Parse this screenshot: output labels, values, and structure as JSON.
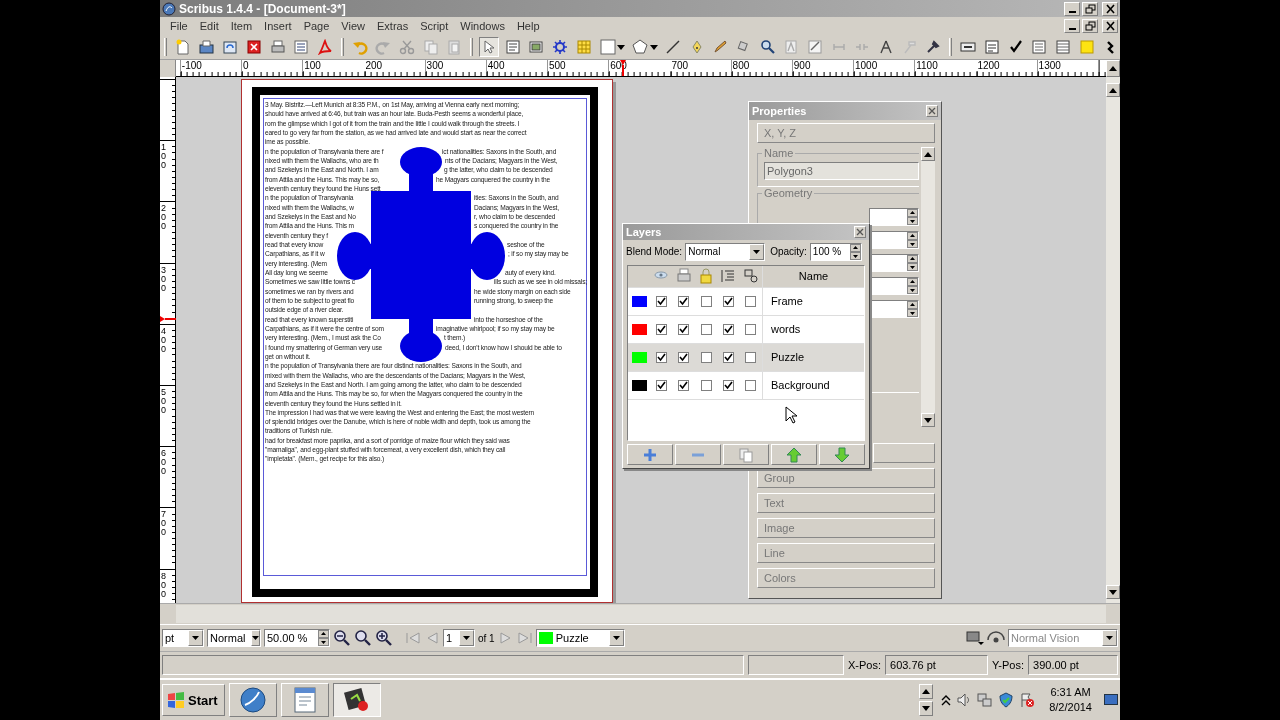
{
  "window": {
    "title": "Scribus 1.4.4 - [Document-3*]"
  },
  "menu": [
    "File",
    "Edit",
    "Item",
    "Insert",
    "Page",
    "View",
    "Extras",
    "Script",
    "Windows",
    "Help"
  ],
  "ruler_h": [
    "-100",
    "0",
    "100",
    "200",
    "300",
    "400",
    "500",
    "600",
    "700",
    "800",
    "900",
    "1000",
    "1100",
    "1200",
    "1300"
  ],
  "ruler_v": [
    "100",
    "200",
    "300",
    "400",
    "500",
    "600",
    "700",
    "800"
  ],
  "document": {
    "lines": [
      {
        "text": "3 May. Bistritz.—Left Munich at 8:35 P.M., on 1st May, arriving at Vienna early next morning;"
      },
      {
        "text": "should have arrived at 6:46, but train was an hour late. Buda-Pesth seems a wonderful place,"
      },
      {
        "text": "rom the glimpse which I got of it from the train and the little I could walk through the streets. I"
      },
      {
        "text": "eared to go very far from the station, as we had arrived late and would start as near the correct"
      },
      {
        "text": "ime as possible."
      },
      {
        "text": "n the population of Transylvania there are f",
        "text_after_puzzle": "ict nationalities: Saxons in the South, and"
      },
      {
        "text": "nixed with them the Wallachs, who are th",
        "text_after_puzzle": "nts of the Dacians; Magyars in the West,"
      },
      {
        "text": "and Szekelys in the East and North. I am",
        "text_after_puzzle": "g the latter, who claim to be descended"
      },
      {
        "text": "from Attila and the Huns. This may be so,",
        "text_after_puzzle": "he Magyars conquered the country in the"
      },
      {
        "text": "eleventh century they found the Huns sett"
      },
      {
        "text": "n the population of Transylvania",
        "text_after_puzzle": "ities: Saxons in the South, and"
      },
      {
        "text": "nixed with them the Wallachs, w",
        "text_after_puzzle": "Dacians; Magyars in the West,"
      },
      {
        "text": "and Szekelys in the East and No",
        "text_after_puzzle": "r, who claim to be descended"
      },
      {
        "text": "from Attila and the Huns. This m",
        "text_after_puzzle": "s conquered the country in the"
      },
      {
        "text": "eleventh century they f"
      },
      {
        "text": "read that every know",
        "text_after_puzzle": "seshoe of the"
      },
      {
        "text": "Carpathians, as if it w",
        "text_after_puzzle": "; if so my stay may be"
      },
      {
        "text": "very interesting. (Mem"
      },
      {
        "text": "All day long we seeme",
        "text_after_puzzle": "auty of every kind."
      },
      {
        "text": "Sometimes we saw little towns c",
        "text_after_puzzle": "ills such as we see in old missals;"
      },
      {
        "text": "sometimes we ran by rivers and",
        "text_after_puzzle": "he wide stony margin on each side"
      },
      {
        "text": "of them to be subject to great flo",
        "text_after_puzzle": "running strong, to sweep the"
      },
      {
        "text": "outside edge of a river clear."
      },
      {
        "text": "read that every known superstiti",
        "text_after_puzzle": "into the horseshoe of the"
      },
      {
        "text": "Carpathians, as if it were the centre of som",
        "text_after_puzzle": "imaginative whirlpool; if so my stay may be"
      },
      {
        "text": "very interesting. (Mem., I must ask the Co",
        "text_after_puzzle": "t them.)"
      },
      {
        "text": "I found my smattering of German very use",
        "text_after_puzzle": "deed, I don't know how I should be able to"
      },
      {
        "text": "get on without it."
      },
      {
        "text": "n the population of Transylvania there are four distinct nationalities: Saxons in the South, and"
      },
      {
        "text": "mixed with them the Wallachs, who are the descendants of the Dacians; Magyars in the West,"
      },
      {
        "text": "and Szekelys in the East and North. I am going among the latter, who claim to be descended"
      },
      {
        "text": "from Attila and the Huns. This may be so, for when the Magyars conquered the country in the"
      },
      {
        "text": "eleventh century they found the Huns settled in it."
      },
      {
        "text": "The impression I had was that we were leaving the West and entering the East; the most western"
      },
      {
        "text": "of splendid bridges over the Danube, which is here of noble width and depth, took us among the"
      },
      {
        "text": "traditions of Turkish rule."
      },
      {
        "text": "had for breakfast more paprika, and a sort of porridge of maize flour which they said was"
      },
      {
        "text": "\"mamaliga\", and egg-plant stuffed with forcemeat, a very excellent dish, which they call"
      },
      {
        "text": "\"impletata\". (Mem., get recipe for this also.)"
      }
    ]
  },
  "properties": {
    "title": "Properties",
    "xyz": "X, Y, Z",
    "name_label": "Name",
    "name_value": "Polygon3",
    "geometry_label": "Geometry",
    "sections": [
      "Group",
      "Text",
      "Image",
      "Line",
      "Colors"
    ]
  },
  "layers": {
    "title": "Layers",
    "blend_label": "Blend Mode:",
    "blend_value": "Normal",
    "opacity_label": "Opacity:",
    "opacity_value": "100 %",
    "name_header": "Name",
    "rows": [
      {
        "name": "Frame",
        "color": "#0000ff",
        "visible": true,
        "printable": true,
        "locked": false,
        "flow": true,
        "outline": false,
        "selected": false
      },
      {
        "name": "words",
        "color": "#ff0000",
        "visible": true,
        "printable": true,
        "locked": false,
        "flow": true,
        "outline": false,
        "selected": false
      },
      {
        "name": "Puzzle",
        "color": "#00ff00",
        "visible": true,
        "printable": true,
        "locked": false,
        "flow": true,
        "outline": false,
        "selected": true
      },
      {
        "name": "Background",
        "color": "#000000",
        "visible": true,
        "printable": true,
        "locked": false,
        "flow": true,
        "outline": false,
        "selected": false
      }
    ]
  },
  "bottom_bar": {
    "unit": "pt",
    "mode": "Normal",
    "zoom": "50.00 %",
    "page": "1",
    "page_count": "of 1",
    "layer": "Puzzle",
    "vision": "Normal Vision"
  },
  "status": {
    "xpos_label": "X-Pos:",
    "xpos": "603.76 pt",
    "ypos_label": "Y-Pos:",
    "ypos": "390.00 pt"
  },
  "taskbar": {
    "start": "Start",
    "time": "6:31 AM",
    "date": "8/2/2014"
  }
}
